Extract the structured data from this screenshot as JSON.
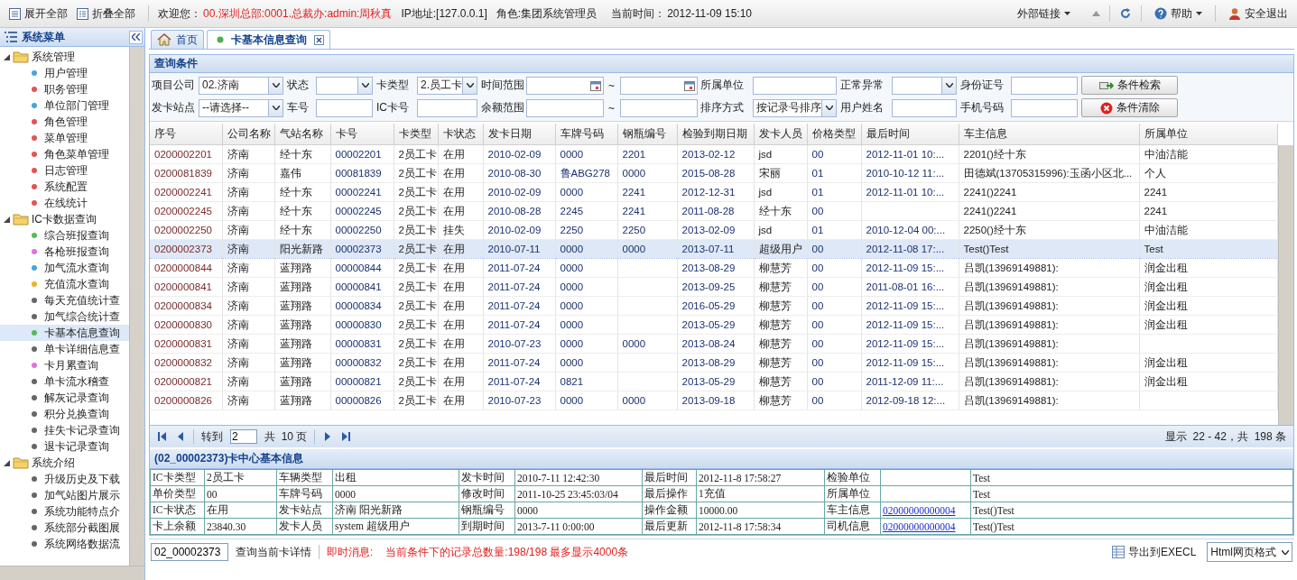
{
  "top_bar": {
    "expand_all": "展开全部",
    "collapse_all": "折叠全部",
    "welcome": "欢迎您：",
    "user": "00.深圳总部:0001.总裁办:admin:周秋真",
    "ip": "IP地址:[127.0.0.1]",
    "role": "角色:集团系统管理员",
    "time_label": "当前时间：",
    "time": "2012-11-09 15:10",
    "links": "外部链接",
    "help": "帮助",
    "logout": "安全退出"
  },
  "sidebar": {
    "title": "系统菜单",
    "tree": [
      {
        "label": "系统管理",
        "expanded": true,
        "children": [
          {
            "label": "用户管理",
            "color": "#4aa3df",
            "selected": false
          },
          {
            "label": "职务管理",
            "color": "#e05555",
            "selected": false
          },
          {
            "label": "单位部门管理",
            "color": "#4aa3df",
            "selected": false
          },
          {
            "label": "角色管理",
            "color": "#e05555",
            "selected": false
          },
          {
            "label": "菜单管理",
            "color": "#e05555",
            "selected": false
          },
          {
            "label": "角色菜单管理",
            "color": "#e05555",
            "selected": false
          },
          {
            "label": "日志管理",
            "color": "#e05555",
            "selected": false
          },
          {
            "label": "系统配置",
            "color": "#e05555",
            "selected": false
          },
          {
            "label": "在线统计",
            "color": "#e05555",
            "selected": false
          }
        ]
      },
      {
        "label": "IC卡数据查询",
        "expanded": true,
        "children": [
          {
            "label": "综合班报查询",
            "color": "#5bb85b",
            "selected": false
          },
          {
            "label": "各枪班报查询",
            "color": "#e070e0",
            "selected": false
          },
          {
            "label": "加气流水查询",
            "color": "#4aa3df",
            "selected": false
          },
          {
            "label": "充值流水查询",
            "color": "#f0b030",
            "selected": false
          },
          {
            "label": "每天充值统计查",
            "color": "#666666",
            "selected": false
          },
          {
            "label": "加气综合统计查",
            "color": "#666666",
            "selected": false
          },
          {
            "label": "卡基本信息查询",
            "color": "#5bb85b",
            "selected": true
          },
          {
            "label": "单卡详细信息查",
            "color": "#666666",
            "selected": false
          },
          {
            "label": "卡月累查询",
            "color": "#e070e0",
            "selected": false
          },
          {
            "label": "单卡流水稽查",
            "color": "#666666",
            "selected": false
          },
          {
            "label": "解灰记录查询",
            "color": "#666666",
            "selected": false
          },
          {
            "label": "积分兑换查询",
            "color": "#666666",
            "selected": false
          },
          {
            "label": "挂失卡记录查询",
            "color": "#666666",
            "selected": false
          },
          {
            "label": "退卡记录查询",
            "color": "#666666",
            "selected": false
          }
        ]
      },
      {
        "label": "系统介绍",
        "expanded": true,
        "children": [
          {
            "label": "升级历史及下载",
            "color": "#666666",
            "selected": false
          },
          {
            "label": "加气站图片展示",
            "color": "#666666",
            "selected": false
          },
          {
            "label": "系统功能特点介",
            "color": "#666666",
            "selected": false
          },
          {
            "label": "系统部分截图展",
            "color": "#666666",
            "selected": false
          },
          {
            "label": "系统网络数据流",
            "color": "#666666",
            "selected": false
          }
        ]
      }
    ]
  },
  "tabs": [
    {
      "label": "首页",
      "kind": "home",
      "selected": false
    },
    {
      "label": "卡基本信息查询",
      "kind": "page",
      "selected": true
    }
  ],
  "query": {
    "title": "查询条件",
    "rows": [
      [
        {
          "label": "项目公司",
          "kind": "select",
          "value": "02.济南"
        },
        {
          "label": "状态",
          "kind": "select"
        },
        {
          "label": "卡类型",
          "kind": "select",
          "value": "2.员工卡"
        },
        {
          "label": "时间范围",
          "kind": "date_range",
          "separator": "~"
        },
        {
          "label": "所属单位",
          "kind": "input"
        },
        {
          "label": "正常异常",
          "kind": "select"
        },
        {
          "label": "身份证号",
          "kind": "input"
        },
        {
          "kind": "button",
          "label": "条件检索"
        }
      ],
      [
        {
          "label": "发卡站点",
          "kind": "select",
          "value": "--请选择--"
        },
        {
          "label": "车号",
          "kind": "input"
        },
        {
          "label": "IC卡号",
          "kind": "input"
        },
        {
          "label": "余额范围",
          "kind": "range",
          "separator": "~"
        },
        {
          "label": "排序方式",
          "kind": "select",
          "value": "按记录号排序"
        },
        {
          "label": "用户姓名",
          "kind": "input"
        },
        {
          "label": "手机号码",
          "kind": "input"
        },
        {
          "kind": "button",
          "label": "条件清除"
        }
      ]
    ]
  },
  "table": {
    "columns": [
      "序号",
      "公司名称",
      "气站名称",
      "卡号",
      "卡类型",
      "卡状态",
      "发卡日期",
      "车牌号码",
      "钢瓶编号",
      "检验到期日期",
      "发卡人员",
      "价格类型",
      "最后时间",
      "车主信息",
      "所属单位"
    ],
    "rows": [
      {
        "selected": false,
        "cells": [
          "0200002201",
          "济南",
          "经十东",
          "00002201",
          "2员工卡",
          "在用",
          "2010-02-09",
          "0000",
          "2201",
          "2013-02-12",
          "jsd",
          "00",
          "2012-11-01 10:...",
          "2201()经十东",
          "中油洁能"
        ]
      },
      {
        "selected": false,
        "cells": [
          "0200081839",
          "济南",
          "嘉伟",
          "00081839",
          "2员工卡",
          "在用",
          "2010-08-30",
          "鲁ABG278",
          "0000",
          "2015-08-28",
          "宋丽",
          "01",
          "2010-10-12 11:...",
          "田德斌(13705315996):玉函小区北...",
          "个人"
        ]
      },
      {
        "selected": false,
        "cells": [
          "0200002241",
          "济南",
          "经十东",
          "00002241",
          "2员工卡",
          "在用",
          "2010-02-09",
          "0000",
          "2241",
          "2012-12-31",
          "jsd",
          "01",
          "2012-11-01 10:...",
          "2241()2241",
          "2241"
        ]
      },
      {
        "selected": false,
        "cells": [
          "0200002245",
          "济南",
          "经十东",
          "00002245",
          "2员工卡",
          "在用",
          "2010-08-28",
          "2245",
          "2241",
          "2011-08-28",
          "经十东",
          "00",
          null,
          "2241()2241",
          "2241"
        ]
      },
      {
        "selected": false,
        "cells": [
          "0200002250",
          "济南",
          "经十东",
          "00002250",
          "2员工卡",
          "挂失",
          "2010-02-09",
          "2250",
          "2250",
          "2013-02-09",
          "jsd",
          "01",
          "2010-12-04 00:...",
          "2250()经十东",
          "中油洁能"
        ]
      },
      {
        "selected": true,
        "cells": [
          "0200002373",
          "济南",
          "阳光新路",
          "00002373",
          "2员工卡",
          "在用",
          "2010-07-11",
          "0000",
          "0000",
          "2013-07-11",
          "超级用户",
          "00",
          "2012-11-08 17:...",
          "Test()Test",
          "Test"
        ]
      },
      {
        "selected": false,
        "cells": [
          "0200000844",
          "济南",
          "蓝翔路",
          "00000844",
          "2员工卡",
          "在用",
          "2011-07-24",
          "0000",
          null,
          "2013-08-29",
          "柳慧芳",
          "00",
          "2012-11-09 15:...",
          "吕凯(13969149881):",
          "润金出租"
        ]
      },
      {
        "selected": false,
        "cells": [
          "0200000841",
          "济南",
          "蓝翔路",
          "00000841",
          "2员工卡",
          "在用",
          "2011-07-24",
          "0000",
          null,
          "2013-09-25",
          "柳慧芳",
          "00",
          "2011-08-01 16:...",
          "吕凯(13969149881):",
          "润金出租"
        ]
      },
      {
        "selected": false,
        "cells": [
          "0200000834",
          "济南",
          "蓝翔路",
          "00000834",
          "2员工卡",
          "在用",
          "2011-07-24",
          "0000",
          null,
          "2016-05-29",
          "柳慧芳",
          "00",
          "2012-11-09 15:...",
          "吕凯(13969149881):",
          "润金出租"
        ]
      },
      {
        "selected": false,
        "cells": [
          "0200000830",
          "济南",
          "蓝翔路",
          "00000830",
          "2员工卡",
          "在用",
          "2011-07-24",
          "0000",
          null,
          "2013-05-29",
          "柳慧芳",
          "00",
          "2012-11-09 15:...",
          "吕凯(13969149881):",
          "润金出租"
        ]
      },
      {
        "selected": false,
        "cells": [
          "0200000831",
          "济南",
          "蓝翔路",
          "00000831",
          "2员工卡",
          "在用",
          "2010-07-23",
          "0000",
          "0000",
          "2013-08-24",
          "柳慧芳",
          "00",
          "2012-11-09 15:...",
          "吕凯(13969149881):",
          null
        ]
      },
      {
        "selected": false,
        "cells": [
          "0200000832",
          "济南",
          "蓝翔路",
          "00000832",
          "2员工卡",
          "在用",
          "2011-07-24",
          "0000",
          null,
          "2013-08-29",
          "柳慧芳",
          "00",
          "2012-11-09 15:...",
          "吕凯(13969149881):",
          "润金出租"
        ]
      },
      {
        "selected": false,
        "cells": [
          "0200000821",
          "济南",
          "蓝翔路",
          "00000821",
          "2员工卡",
          "在用",
          "2011-07-24",
          "0821",
          null,
          "2013-05-29",
          "柳慧芳",
          "00",
          "2011-12-09 11:...",
          "吕凯(13969149881):",
          "润金出租"
        ]
      },
      {
        "selected": false,
        "cells": [
          "0200000826",
          "济南",
          "蓝翔路",
          "00000826",
          "2员工卡",
          "在用",
          "2010-07-23",
          "0000",
          "0000",
          "2013-09-18",
          "柳慧芳",
          "00",
          "2012-09-18 12:...",
          "吕凯(13969149881):",
          null
        ]
      }
    ]
  },
  "pager": {
    "go_to": "转到",
    "page": "2",
    "total_pages": "共  10 页",
    "display": "显示  22 - 42，共  198 条"
  },
  "detail": {
    "title": "(02_00002373)卡中心基本信息",
    "rows": [
      {
        "cells": [
          {
            "label": "IC卡类型",
            "value": "2员工卡"
          },
          {
            "label": "车辆类型",
            "value": "出租"
          },
          {
            "label": "发卡时间",
            "value": "2010-7-11 12:42:30"
          },
          {
            "label": "最后时间",
            "value": "2012-11-8 17:58:27"
          },
          {
            "label": "检验单位"
          }
        ],
        "extra": "Test"
      },
      {
        "cells": [
          {
            "label": "单价类型",
            "value": "00"
          },
          {
            "label": "车牌号码",
            "value": "0000"
          },
          {
            "label": "修改时间",
            "value": "2011-10-25 23:45:03/04"
          },
          {
            "label": "最后操作",
            "value": "1充值"
          },
          {
            "label": "所属单位"
          }
        ],
        "extra": "Test"
      },
      {
        "cells": [
          {
            "label": "IC卡状态",
            "value": "在用"
          },
          {
            "label": "发卡站点",
            "value": "济南 阳光新路"
          },
          {
            "label": "钢瓶编号",
            "value": "0000"
          },
          {
            "label": "操作金额",
            "value": "10000.00"
          },
          {
            "label": "车主信息",
            "value": "02000000000004",
            "kind": "link"
          }
        ],
        "extra": "Test()Test"
      },
      {
        "cells": [
          {
            "label": "卡上余额",
            "value": "23840.30"
          },
          {
            "label": "发卡人员",
            "value": "system 超级用户"
          },
          {
            "label": "到期时间",
            "value": "2013-7-11 0:00:00"
          },
          {
            "label": "最后更新",
            "value": "2012-11-8 17:58:34"
          },
          {
            "label": "司机信息",
            "value": "02000000000004",
            "kind": "link"
          }
        ],
        "extra": "Test()Test"
      }
    ]
  },
  "status_bar": {
    "card": "02_00002373",
    "card_detail": "查询当前卡详情",
    "message_label": "即时消息:",
    "message": "当前条件下的记录总数量:198/198 最多显示4000条",
    "export": "导出到EXECL",
    "format": "Html网页格式"
  }
}
